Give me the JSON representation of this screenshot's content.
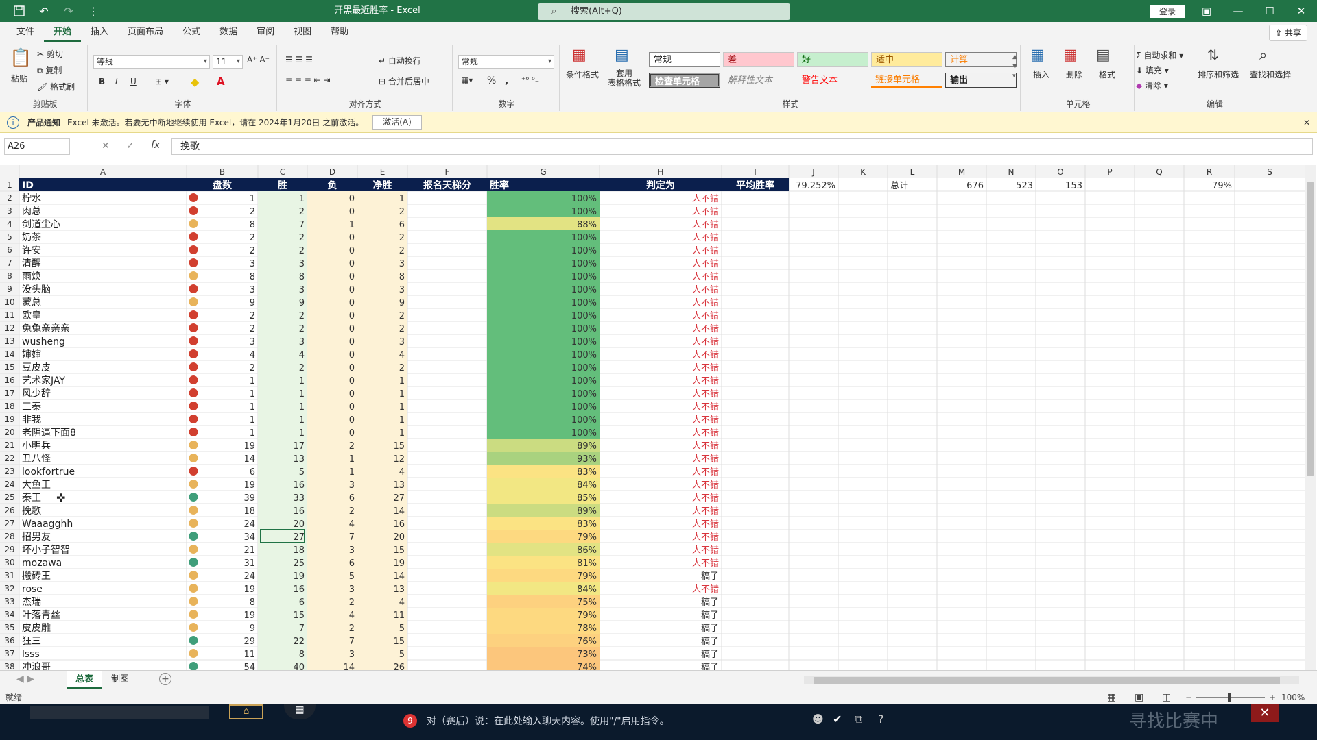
{
  "window": {
    "title": "开黑最近胜率  -  Excel",
    "search_placeholder": "搜索(Alt+Q)",
    "login": "登录",
    "minimize": "—",
    "maximize": "☐",
    "close": "✕"
  },
  "menu": {
    "items": [
      "文件",
      "开始",
      "插入",
      "页面布局",
      "公式",
      "数据",
      "审阅",
      "视图",
      "帮助"
    ],
    "share": "共享"
  },
  "ribbon": {
    "clipboard": {
      "label": "剪贴板",
      "paste": "粘贴",
      "cut": "剪切",
      "copy": "复制",
      "format_painter": "格式刷"
    },
    "font": {
      "label": "字体",
      "family": "等线",
      "size": "11",
      "bold": "B",
      "italic": "I",
      "underline": "U"
    },
    "alignment": {
      "label": "对齐方式",
      "wrap": "自动换行",
      "merge": "合并后居中"
    },
    "number": {
      "label": "数字",
      "format": "常规",
      "percent": "%",
      "comma": ","
    },
    "styles": {
      "label": "样式",
      "conditional": "条件格式",
      "table_format": "套用\n表格格式",
      "style_cells": [
        "常规",
        "差",
        "好",
        "适中",
        "计算",
        "检查单元格",
        "解释性文本",
        "警告文本",
        "链接单元格",
        "输出"
      ]
    },
    "cells": {
      "label": "单元格",
      "insert": "插入",
      "delete": "删除",
      "format": "格式"
    },
    "editing": {
      "label": "编辑",
      "autosum": "自动求和",
      "fill": "填充",
      "clear": "清除",
      "sort_filter": "排序和筛选",
      "find_select": "查找和选择"
    }
  },
  "notice": {
    "title": "产品通知",
    "text": "Excel 未激活。若要无中断地继续使用 Excel，请在 2024年1月20日 之前激活。",
    "button": "激活(A)",
    "close": "✕"
  },
  "formula_bar": {
    "name_box": "A26",
    "cancel": "✕",
    "enter": "✓",
    "fx": "fx",
    "content": "挽歌"
  },
  "sheet": {
    "columns": [
      "A",
      "B",
      "C",
      "D",
      "E",
      "F",
      "G",
      "H",
      "I",
      "J",
      "K",
      "L",
      "M",
      "N",
      "O",
      "P",
      "Q",
      "R",
      "S"
    ],
    "header": [
      "ID",
      "盘数",
      "胜",
      "负",
      "净胜",
      "报名天梯分",
      "胜率",
      "判定为",
      "平均胜率"
    ],
    "summary": {
      "avg_rate": "79.252%",
      "total_label": "总计",
      "m": "676",
      "n": "523",
      "o": "153",
      "r": "79%"
    },
    "rows": [
      {
        "r": 2,
        "id": "柠水",
        "dot": "red",
        "b": 1,
        "c": 1,
        "d": 0,
        "e": 1,
        "g": "100%",
        "h": "人不错"
      },
      {
        "r": 3,
        "id": "肉总",
        "dot": "red",
        "b": 2,
        "c": 2,
        "d": 0,
        "e": 2,
        "g": "100%",
        "h": "人不错"
      },
      {
        "r": 4,
        "id": "剑道尘心",
        "dot": "yellow",
        "b": 8,
        "c": 7,
        "d": 1,
        "e": 6,
        "g": "88%",
        "h": "人不错"
      },
      {
        "r": 5,
        "id": "奶茶",
        "dot": "red",
        "b": 2,
        "c": 2,
        "d": 0,
        "e": 2,
        "g": "100%",
        "h": "人不错"
      },
      {
        "r": 6,
        "id": "许安",
        "dot": "red",
        "b": 2,
        "c": 2,
        "d": 0,
        "e": 2,
        "g": "100%",
        "h": "人不错"
      },
      {
        "r": 7,
        "id": "清醒",
        "dot": "red",
        "b": 3,
        "c": 3,
        "d": 0,
        "e": 3,
        "g": "100%",
        "h": "人不错"
      },
      {
        "r": 8,
        "id": "雨焕",
        "dot": "yellow",
        "b": 8,
        "c": 8,
        "d": 0,
        "e": 8,
        "g": "100%",
        "h": "人不错"
      },
      {
        "r": 9,
        "id": "没头脑",
        "dot": "red",
        "b": 3,
        "c": 3,
        "d": 0,
        "e": 3,
        "g": "100%",
        "h": "人不错"
      },
      {
        "r": 10,
        "id": "蒙总",
        "dot": "yellow",
        "b": 9,
        "c": 9,
        "d": 0,
        "e": 9,
        "g": "100%",
        "h": "人不错"
      },
      {
        "r": 11,
        "id": "欧皇",
        "dot": "red",
        "b": 2,
        "c": 2,
        "d": 0,
        "e": 2,
        "g": "100%",
        "h": "人不错"
      },
      {
        "r": 12,
        "id": "兔兔亲亲亲",
        "dot": "red",
        "b": 2,
        "c": 2,
        "d": 0,
        "e": 2,
        "g": "100%",
        "h": "人不错"
      },
      {
        "r": 13,
        "id": "wusheng",
        "dot": "red",
        "b": 3,
        "c": 3,
        "d": 0,
        "e": 3,
        "g": "100%",
        "h": "人不错"
      },
      {
        "r": 14,
        "id": "婶婶",
        "dot": "red",
        "b": 4,
        "c": 4,
        "d": 0,
        "e": 4,
        "g": "100%",
        "h": "人不错"
      },
      {
        "r": 15,
        "id": "豆皮皮",
        "dot": "red",
        "b": 2,
        "c": 2,
        "d": 0,
        "e": 2,
        "g": "100%",
        "h": "人不错"
      },
      {
        "r": 16,
        "id": "艺术家JAY",
        "dot": "red",
        "b": 1,
        "c": 1,
        "d": 0,
        "e": 1,
        "g": "100%",
        "h": "人不错"
      },
      {
        "r": 17,
        "id": "风少辞",
        "dot": "red",
        "b": 1,
        "c": 1,
        "d": 0,
        "e": 1,
        "g": "100%",
        "h": "人不错"
      },
      {
        "r": 18,
        "id": "三秦",
        "dot": "red",
        "b": 1,
        "c": 1,
        "d": 0,
        "e": 1,
        "g": "100%",
        "h": "人不错"
      },
      {
        "r": 19,
        "id": "非我",
        "dot": "red",
        "b": 1,
        "c": 1,
        "d": 0,
        "e": 1,
        "g": "100%",
        "h": "人不错"
      },
      {
        "r": 20,
        "id": "老阴逼下面8",
        "dot": "red",
        "b": 1,
        "c": 1,
        "d": 0,
        "e": 1,
        "g": "100%",
        "h": "人不错"
      },
      {
        "r": 21,
        "id": "小明兵",
        "dot": "yellow",
        "b": 19,
        "c": 17,
        "d": 2,
        "e": 15,
        "g": "89%",
        "h": "人不错"
      },
      {
        "r": 22,
        "id": "丑八怪",
        "dot": "yellow",
        "b": 14,
        "c": 13,
        "d": 1,
        "e": 12,
        "g": "93%",
        "h": "人不错"
      },
      {
        "r": 23,
        "id": "lookfortrue",
        "dot": "red",
        "b": 6,
        "c": 5,
        "d": 1,
        "e": 4,
        "g": "83%",
        "h": "人不错"
      },
      {
        "r": 24,
        "id": "大鱼王",
        "dot": "yellow",
        "b": 19,
        "c": 16,
        "d": 3,
        "e": 13,
        "g": "84%",
        "h": "人不错"
      },
      {
        "r": 25,
        "id": "秦王",
        "dot": "green",
        "b": 39,
        "c": 33,
        "d": 6,
        "e": 27,
        "g": "85%",
        "h": "人不错"
      },
      {
        "r": 26,
        "id": "挽歌",
        "dot": "yellow",
        "b": 18,
        "c": 16,
        "d": 2,
        "e": 14,
        "g": "89%",
        "h": "人不错"
      },
      {
        "r": 27,
        "id": "Waaagghh",
        "dot": "yellow",
        "b": 24,
        "c": 20,
        "d": 4,
        "e": 16,
        "g": "83%",
        "h": "人不错"
      },
      {
        "r": 28,
        "id": "招男友",
        "dot": "green",
        "b": 34,
        "c": 27,
        "d": 7,
        "e": 20,
        "g": "79%",
        "h": "人不错"
      },
      {
        "r": 29,
        "id": "坏小子智智",
        "dot": "yellow",
        "b": 21,
        "c": 18,
        "d": 3,
        "e": 15,
        "g": "86%",
        "h": "人不错"
      },
      {
        "r": 30,
        "id": "mozawa",
        "dot": "green",
        "b": 31,
        "c": 25,
        "d": 6,
        "e": 19,
        "g": "81%",
        "h": "人不错"
      },
      {
        "r": 31,
        "id": "搬砖王",
        "dot": "yellow",
        "b": 24,
        "c": 19,
        "d": 5,
        "e": 14,
        "g": "79%",
        "h": "稿子"
      },
      {
        "r": 32,
        "id": "rose",
        "dot": "yellow",
        "b": 19,
        "c": 16,
        "d": 3,
        "e": 13,
        "g": "84%",
        "h": "人不错"
      },
      {
        "r": 33,
        "id": "杰瑞",
        "dot": "yellow",
        "b": 8,
        "c": 6,
        "d": 2,
        "e": 4,
        "g": "75%",
        "h": "稿子"
      },
      {
        "r": 34,
        "id": "叶落青丝",
        "dot": "yellow",
        "b": 19,
        "c": 15,
        "d": 4,
        "e": 11,
        "g": "79%",
        "h": "稿子"
      },
      {
        "r": 35,
        "id": "皮皮雕",
        "dot": "yellow",
        "b": 9,
        "c": 7,
        "d": 2,
        "e": 5,
        "g": "78%",
        "h": "稿子"
      },
      {
        "r": 36,
        "id": "狂三",
        "dot": "green",
        "b": 29,
        "c": 22,
        "d": 7,
        "e": 15,
        "g": "76%",
        "h": "稿子"
      },
      {
        "r": 37,
        "id": "lsss",
        "dot": "yellow",
        "b": 11,
        "c": 8,
        "d": 3,
        "e": 5,
        "g": "73%",
        "h": "稿子"
      },
      {
        "r": 38,
        "id": "冲浪哥",
        "dot": "green",
        "b": 54,
        "c": 40,
        "d": 14,
        "e": 26,
        "g": "74%",
        "h": "稿子"
      }
    ]
  },
  "tabs": [
    "总表",
    "制图"
  ],
  "status": {
    "ready": "就绪",
    "zoom": "100%"
  },
  "taskbar": {
    "badge": "9",
    "chat": "对（赛后）说：在此处输入聊天内容。使用\"/\"启用指令。",
    "overlay": "寻找比赛中"
  },
  "colors": {
    "excel_green": "#217346",
    "header_navy": "#0b1f4d",
    "red_dot": "#d13f2f",
    "yellow_dot": "#e8b35a",
    "green_dot": "#3f9e7a",
    "verdict_good": "#d9363e"
  }
}
